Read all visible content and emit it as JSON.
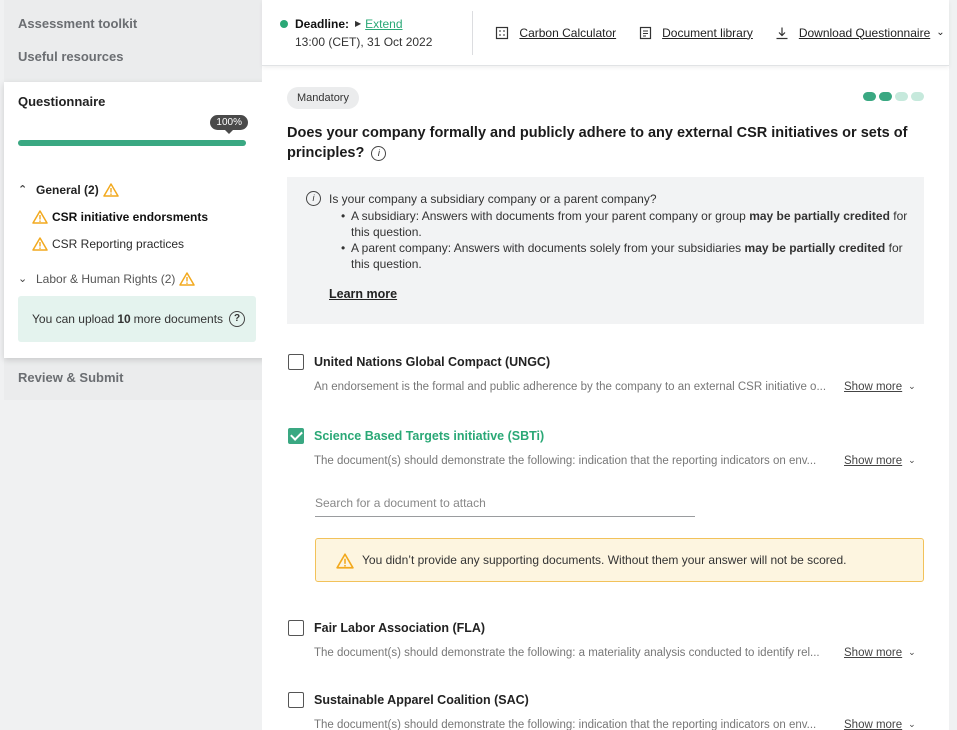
{
  "sidebar": {
    "assessment_toolkit": "Assessment toolkit",
    "useful_resources": "Useful resources",
    "questionnaire": "Questionnaire",
    "progress_label": "100%",
    "progress": 1.0,
    "groups": [
      {
        "label": "General (2)"
      },
      {
        "label": "Labor & Human Rights (2)"
      }
    ],
    "items": [
      {
        "label": "CSR initiative endorsments"
      },
      {
        "label": "CSR Reporting practices"
      }
    ],
    "upload": {
      "prefix": "You can upload",
      "count": "10",
      "suffix": "more documents"
    },
    "review_submit": "Review & Submit"
  },
  "topbar": {
    "deadline_label": "Deadline:",
    "extend": "Extend",
    "deadline_time": "13:00 (CET), 31 Oct 2022",
    "carbon_calculator": "Carbon Calculator",
    "document_library": "Document library",
    "download_questionnaire": "Download Questionnaire"
  },
  "question": {
    "badge": "Mandatory",
    "title": "Does your company formally and publicly adhere to any external CSR initiatives or sets of principles?",
    "info": {
      "intro": "Is your company a subsidiary company or a parent company?",
      "b1_pre": "A subsidiary: Answers with documents from your parent company or group",
      "b1_bold": "may be partially credited",
      "b1_post": "for this question.",
      "b2_pre": "A parent company: Answers with documents solely from your subsidiaries",
      "b2_bold": "may be partially credited",
      "b2_post": "for this question.",
      "learn_more": "Learn more"
    }
  },
  "options": [
    {
      "label": "United Nations Global Compact (UNGC)",
      "desc": "An endorsement is the formal and public adherence by the company to an external CSR initiative o...",
      "checked": false
    },
    {
      "label": "Science Based Targets initiative (SBTi)",
      "desc": "The document(s) should demonstrate the following: indication that the reporting indicators on env...",
      "checked": true
    },
    {
      "label": "Fair Labor Association (FLA)",
      "desc": "The document(s) should demonstrate the following: a materiality analysis conducted to identify rel...",
      "checked": false
    },
    {
      "label": "Sustainable Apparel Coalition (SAC)",
      "desc": "The document(s) should demonstrate the following: indication that the reporting indicators on env...",
      "checked": false
    }
  ],
  "show_more": "Show more",
  "search_placeholder": "Search for a document to attach",
  "warning": "You didn’t provide any supporting documents. Without them your answer will not be scored.",
  "colors": {
    "accent": "#3aa882",
    "warning": "#f2a91e"
  }
}
